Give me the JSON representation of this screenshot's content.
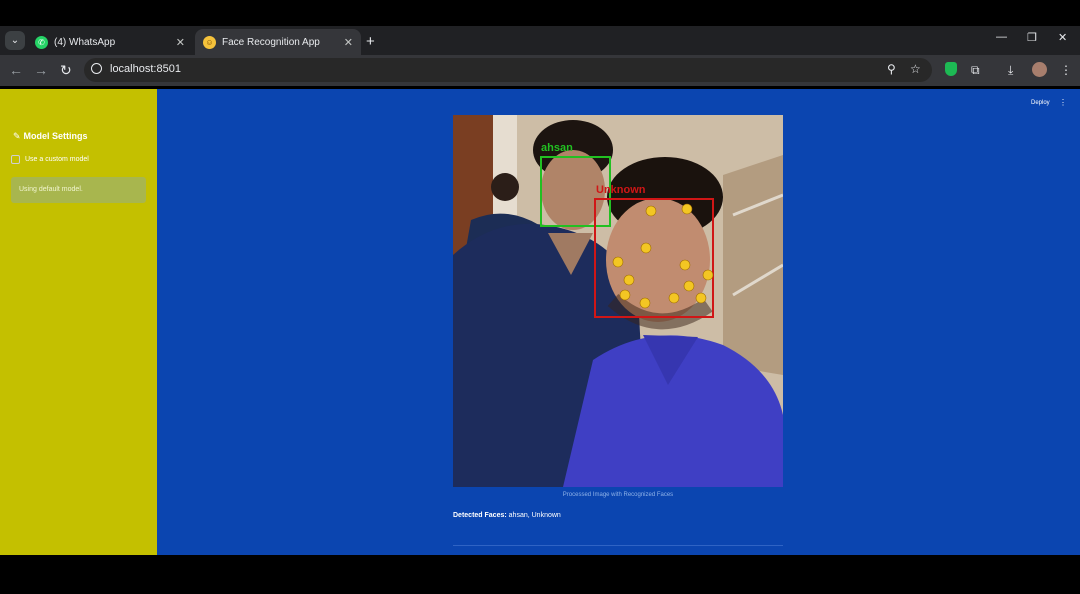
{
  "browser": {
    "tabs": [
      {
        "label": "(4) WhatsApp",
        "icon": "whatsapp-icon",
        "active": false
      },
      {
        "label": "Face Recognition App",
        "icon": "emoji-face-icon",
        "active": true
      }
    ],
    "url": "localhost:8501"
  },
  "sidebar": {
    "title": "Model Settings",
    "title_icon": "pencil-icon",
    "checkbox_label": "Use a custom model",
    "info_text": "Using default model."
  },
  "app": {
    "deploy_label": "Deploy",
    "image_caption": "Processed Image with Recognized Faces",
    "detected_label": "Detected Faces:",
    "detected_value": "ahsan, Unknown",
    "face_labels": {
      "face1": "ahsan",
      "face2": "Unknown"
    }
  },
  "colors": {
    "sidebar_bg": "#c4c000",
    "main_bg": "#0b45b0",
    "known_box": "#22c022",
    "unknown_box": "#d01616"
  }
}
